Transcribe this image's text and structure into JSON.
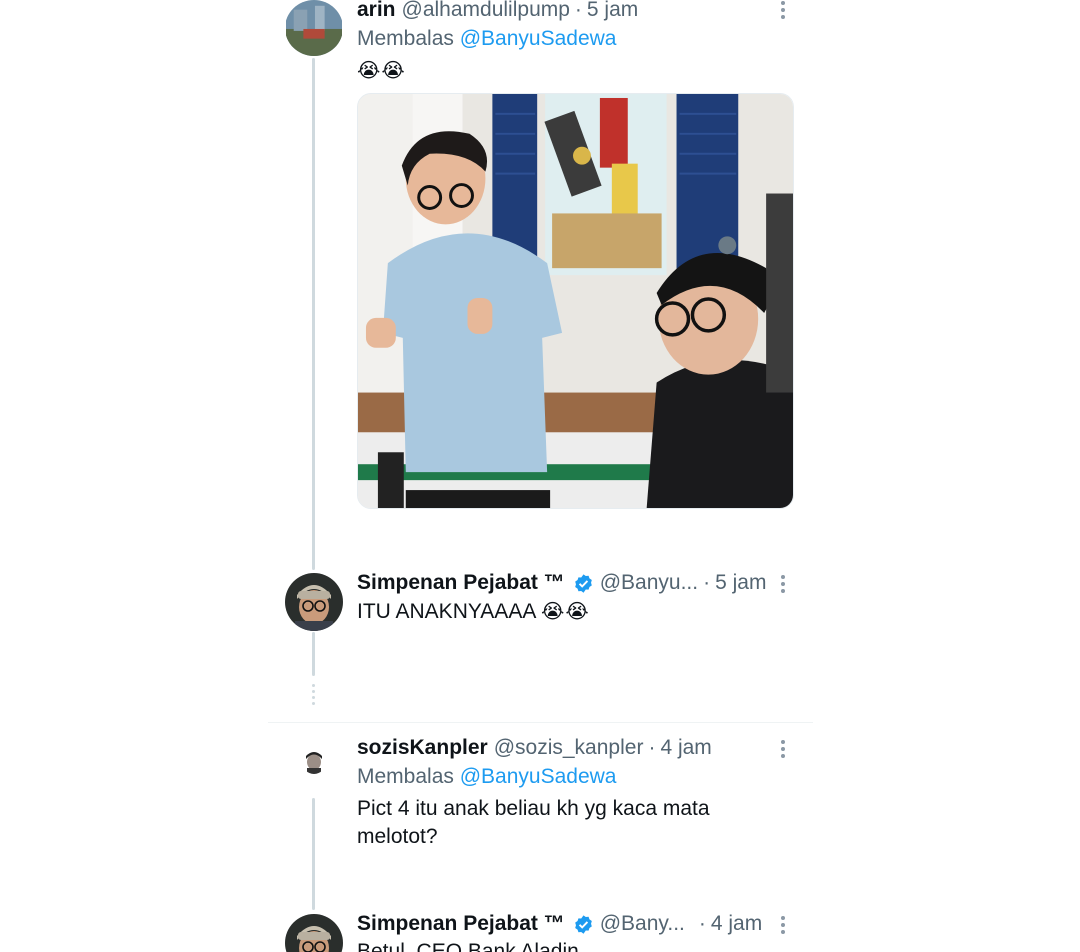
{
  "tweets": [
    {
      "name": "arin",
      "handle": "@alhamdulilpump",
      "time": "5 jam",
      "reply_prefix": "Membalas",
      "reply_to": "@BanyuSadewa",
      "text": "",
      "emoji": "😭😭",
      "has_photo": true
    },
    {
      "name": "Simpenan Pejabat ™",
      "handle": "@Banyu...",
      "time": "5 jam",
      "verified": true,
      "text": "ITU ANAKNYAAAA",
      "emoji": "😭😭"
    },
    {
      "name": "sozisKanpler",
      "handle": "@sozis_kanpler",
      "time": "4 jam",
      "reply_prefix": "Membalas",
      "reply_to": "@BanyuSadewa",
      "text_line1": "Pict 4 itu anak beliau kh yg kaca mata",
      "text_line2": "melotot?"
    },
    {
      "name": "Simpenan Pejabat ™",
      "handle": "@Bany...",
      "time": "4 jam",
      "verified": true,
      "text": "Betul, CEO Bank Aladin"
    }
  ],
  "separator": "·",
  "colors": {
    "accent": "#1d9bf0",
    "secondary_text": "#536471",
    "thread_line": "#cfd9de"
  }
}
